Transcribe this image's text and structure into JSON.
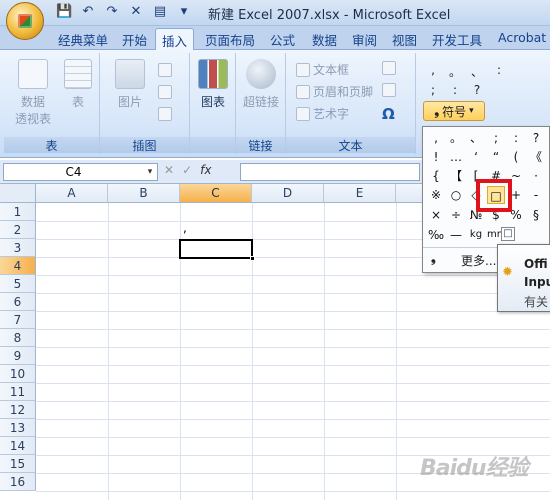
{
  "window": {
    "title": "新建 Excel 2007.xlsx - Microsoft Excel"
  },
  "tabs": [
    "经典菜单",
    "开始",
    "插入",
    "页面布局",
    "公式",
    "数据",
    "审阅",
    "视图",
    "开发工具",
    "Acrobat"
  ],
  "active_tab": "插入",
  "ribbon": {
    "table_group": {
      "label": "表",
      "pivot_line1": "数据",
      "pivot_line2": "透视表",
      "table": "表"
    },
    "illustration_group": {
      "label": "插图",
      "picture": "图片"
    },
    "chart_group": {
      "chart": "图表"
    },
    "link_group": {
      "label": "链接",
      "hyperlink": "超链接"
    },
    "text_group": {
      "label": "文本",
      "textbox": "文本框",
      "header_footer": "页眉和页脚",
      "wordart": "艺术字",
      "omega": "Ω"
    },
    "symbols": {
      "row1": [
        ",",
        "。",
        "、",
        ":"
      ],
      "row2": [
        ";",
        ":",
        "?"
      ],
      "symbol_button": "符号"
    }
  },
  "formula_bar": {
    "name_box": "C4",
    "fx": "fx"
  },
  "columns": [
    "A",
    "B",
    "C",
    "D",
    "E"
  ],
  "selected_column": "C",
  "rows": [
    "1",
    "2",
    "3",
    "4",
    "5",
    "6",
    "7",
    "8",
    "9",
    "10",
    "11",
    "12",
    "13",
    "14",
    "15",
    "16"
  ],
  "selected_row": "4",
  "cell_c3": ",",
  "dropdown": {
    "symbols": [
      ",",
      "。",
      "、",
      ";",
      ":",
      "?",
      "!",
      "…",
      "‘",
      "“",
      "(",
      "《",
      "{",
      "【",
      "[",
      "#",
      "~",
      "·",
      "※",
      "○",
      "◇",
      "□",
      "+",
      "-",
      "×",
      "÷",
      "№",
      "$",
      "%",
      "§",
      "‰",
      "—",
      "kg",
      "mm",
      "",
      ""
    ],
    "highlighted": "□",
    "more": "更多..."
  },
  "tooltip": {
    "line1": "Offi",
    "line2": "Inpu",
    "line3": "有关"
  },
  "watermark": "Baidu经验"
}
